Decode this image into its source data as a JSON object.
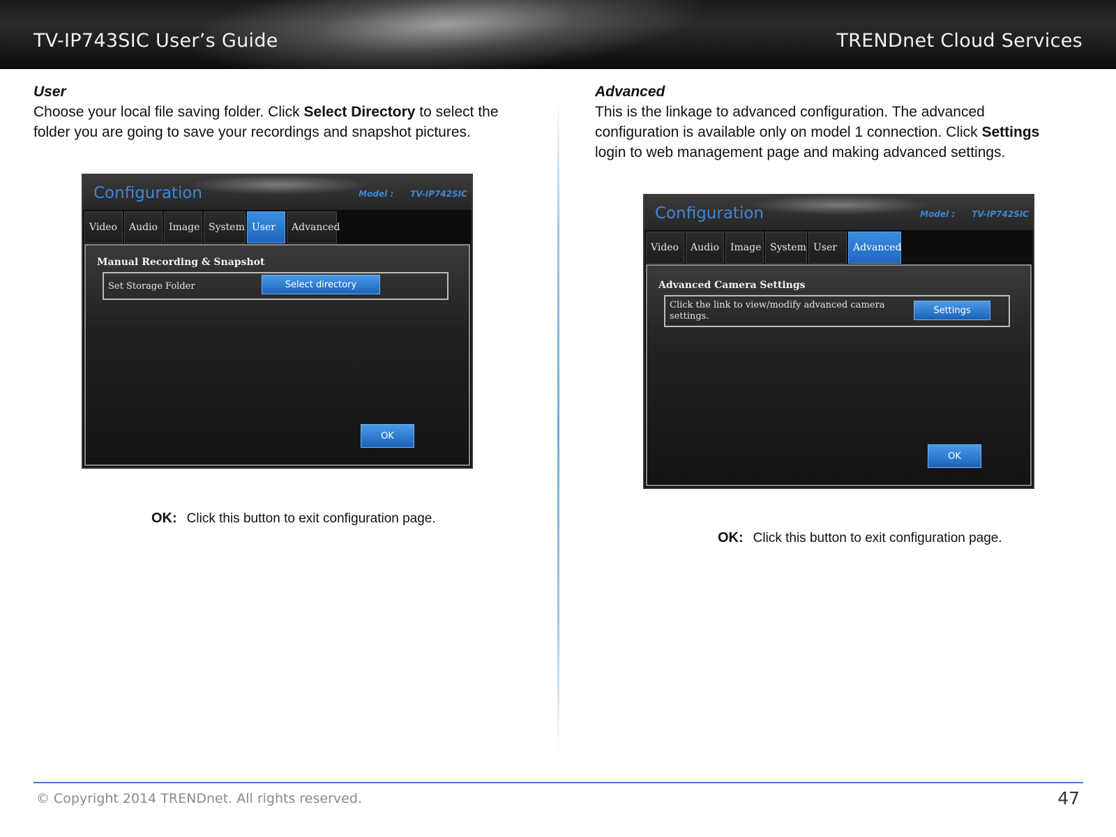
{
  "header": {
    "left_title": "TV-IP743SIC User’s Guide",
    "right_title": "TRENDnet Cloud Services"
  },
  "left": {
    "heading": "User",
    "body_pre": "Choose your local file saving folder. Click ",
    "body_bold": "Select Directory",
    "body_post": " to select the folder you are going to save your recordings and snapshot pictures.",
    "screenshot": {
      "title": "Configuration",
      "model_label": "Model :",
      "model_value": "TV-IP742SIC",
      "tabs": [
        "Video",
        "Audio",
        "Image",
        "System",
        "User",
        "Advanced"
      ],
      "active_tab": "User",
      "group_title": "Manual Recording & Snapshot",
      "row_label": "Set Storage Folder",
      "row_button": "Select directory",
      "ok_button": "OK"
    },
    "caption_key": "OK:",
    "caption_text": "Click this button to exit configuration page."
  },
  "right": {
    "heading": "Advanced",
    "body_pre": "This is the linkage to advanced configuration. The advanced configuration is available only on model 1 connection. Click ",
    "body_bold": "Settings",
    "body_post": " login to web management page and making advanced settings.",
    "screenshot": {
      "title": "Configuration",
      "model_label": "Model :",
      "model_value": "TV-IP742SIC",
      "tabs": [
        "Video",
        "Audio",
        "Image",
        "System",
        "User",
        "Advanced"
      ],
      "active_tab": "Advanced",
      "group_title": "Advanced Camera Settings",
      "row_label": "Click the link to view/modify advanced camera settings.",
      "row_button": "Settings",
      "ok_button": "OK"
    },
    "caption_key": "OK:",
    "caption_text": "Click this button to exit configuration page."
  },
  "footer": {
    "copyright": "© Copyright 2014 TRENDnet. All rights reserved.",
    "page_number": "47"
  },
  "colors": {
    "accent_blue": "#3e86d6",
    "footer_line": "#3a7fc7",
    "active_tab": "#2a78d0"
  }
}
